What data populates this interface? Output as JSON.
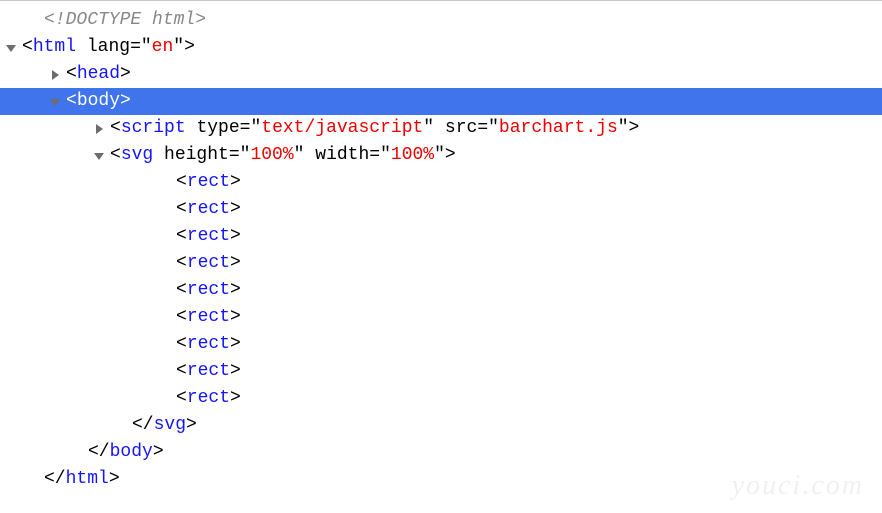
{
  "watermark": "youci.com",
  "rows": [
    {
      "depth": 1,
      "toggle": "none",
      "selected": false,
      "segments": [
        {
          "t": "<!DOCTYPE html>",
          "c": "doctype"
        }
      ]
    },
    {
      "depth": 0,
      "toggle": "open",
      "selected": false,
      "segments": [
        {
          "t": "<",
          "c": "pn"
        },
        {
          "t": "html",
          "c": "tg"
        },
        {
          "t": " ",
          "c": "pn"
        },
        {
          "t": "lang",
          "c": "an"
        },
        {
          "t": "=\"",
          "c": "pn"
        },
        {
          "t": "en",
          "c": "av"
        },
        {
          "t": "\">",
          "c": "pn"
        }
      ]
    },
    {
      "depth": 2,
      "toggle": "closed",
      "selected": false,
      "segments": [
        {
          "t": "<",
          "c": "pn"
        },
        {
          "t": "head",
          "c": "tg"
        },
        {
          "t": ">",
          "c": "pn"
        }
      ]
    },
    {
      "depth": 2,
      "toggle": "open",
      "selected": true,
      "segments": [
        {
          "t": "<",
          "c": "pn"
        },
        {
          "t": "body",
          "c": "tg"
        },
        {
          "t": ">",
          "c": "pn"
        }
      ]
    },
    {
      "depth": 4,
      "toggle": "closed",
      "selected": false,
      "segments": [
        {
          "t": "<",
          "c": "pn"
        },
        {
          "t": "script",
          "c": "tg"
        },
        {
          "t": " ",
          "c": "pn"
        },
        {
          "t": "type",
          "c": "an"
        },
        {
          "t": "=\"",
          "c": "pn"
        },
        {
          "t": "text/javascript",
          "c": "av"
        },
        {
          "t": "\" ",
          "c": "pn"
        },
        {
          "t": "src",
          "c": "an"
        },
        {
          "t": "=\"",
          "c": "pn"
        },
        {
          "t": "barchart.js",
          "c": "av"
        },
        {
          "t": "\">",
          "c": "pn"
        }
      ]
    },
    {
      "depth": 4,
      "toggle": "open",
      "selected": false,
      "segments": [
        {
          "t": "<",
          "c": "pn"
        },
        {
          "t": "svg",
          "c": "tg"
        },
        {
          "t": " ",
          "c": "pn"
        },
        {
          "t": "height",
          "c": "an"
        },
        {
          "t": "=\"",
          "c": "pn"
        },
        {
          "t": "100%",
          "c": "av"
        },
        {
          "t": "\" ",
          "c": "pn"
        },
        {
          "t": "width",
          "c": "an"
        },
        {
          "t": "=\"",
          "c": "pn"
        },
        {
          "t": "100%",
          "c": "av"
        },
        {
          "t": "\">",
          "c": "pn"
        }
      ]
    },
    {
      "depth": 7,
      "toggle": "none",
      "selected": false,
      "segments": [
        {
          "t": "<",
          "c": "pn"
        },
        {
          "t": "rect",
          "c": "tg"
        },
        {
          "t": ">",
          "c": "pn"
        }
      ]
    },
    {
      "depth": 7,
      "toggle": "none",
      "selected": false,
      "segments": [
        {
          "t": "<",
          "c": "pn"
        },
        {
          "t": "rect",
          "c": "tg"
        },
        {
          "t": ">",
          "c": "pn"
        }
      ]
    },
    {
      "depth": 7,
      "toggle": "none",
      "selected": false,
      "segments": [
        {
          "t": "<",
          "c": "pn"
        },
        {
          "t": "rect",
          "c": "tg"
        },
        {
          "t": ">",
          "c": "pn"
        }
      ]
    },
    {
      "depth": 7,
      "toggle": "none",
      "selected": false,
      "segments": [
        {
          "t": "<",
          "c": "pn"
        },
        {
          "t": "rect",
          "c": "tg"
        },
        {
          "t": ">",
          "c": "pn"
        }
      ]
    },
    {
      "depth": 7,
      "toggle": "none",
      "selected": false,
      "segments": [
        {
          "t": "<",
          "c": "pn"
        },
        {
          "t": "rect",
          "c": "tg"
        },
        {
          "t": ">",
          "c": "pn"
        }
      ]
    },
    {
      "depth": 7,
      "toggle": "none",
      "selected": false,
      "segments": [
        {
          "t": "<",
          "c": "pn"
        },
        {
          "t": "rect",
          "c": "tg"
        },
        {
          "t": ">",
          "c": "pn"
        }
      ]
    },
    {
      "depth": 7,
      "toggle": "none",
      "selected": false,
      "segments": [
        {
          "t": "<",
          "c": "pn"
        },
        {
          "t": "rect",
          "c": "tg"
        },
        {
          "t": ">",
          "c": "pn"
        }
      ]
    },
    {
      "depth": 7,
      "toggle": "none",
      "selected": false,
      "segments": [
        {
          "t": "<",
          "c": "pn"
        },
        {
          "t": "rect",
          "c": "tg"
        },
        {
          "t": ">",
          "c": "pn"
        }
      ]
    },
    {
      "depth": 7,
      "toggle": "none",
      "selected": false,
      "segments": [
        {
          "t": "<",
          "c": "pn"
        },
        {
          "t": "rect",
          "c": "tg"
        },
        {
          "t": ">",
          "c": "pn"
        }
      ]
    },
    {
      "depth": 5,
      "toggle": "none",
      "selected": false,
      "segments": [
        {
          "t": "</",
          "c": "pn"
        },
        {
          "t": "svg",
          "c": "tg"
        },
        {
          "t": ">",
          "c": "pn"
        }
      ]
    },
    {
      "depth": 3,
      "toggle": "none",
      "selected": false,
      "segments": [
        {
          "t": "</",
          "c": "pn"
        },
        {
          "t": "body",
          "c": "tg"
        },
        {
          "t": ">",
          "c": "pn"
        }
      ]
    },
    {
      "depth": 1,
      "toggle": "none",
      "selected": false,
      "segments": [
        {
          "t": "</",
          "c": "pn"
        },
        {
          "t": "html",
          "c": "tg"
        },
        {
          "t": ">",
          "c": "pn"
        }
      ]
    }
  ]
}
